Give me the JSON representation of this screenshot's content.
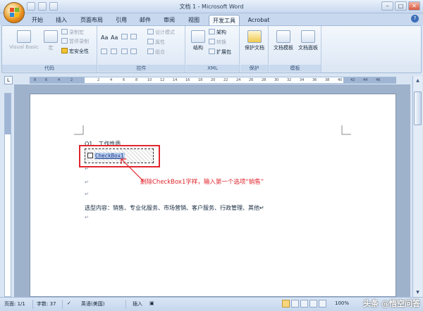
{
  "window": {
    "title": "文档 1 - Microsoft Word",
    "minimize": "–",
    "maximize": "□",
    "close": "✕"
  },
  "tabs": [
    {
      "label": "开始"
    },
    {
      "label": "插入"
    },
    {
      "label": "页面布局"
    },
    {
      "label": "引用"
    },
    {
      "label": "邮件"
    },
    {
      "label": "审阅"
    },
    {
      "label": "视图"
    },
    {
      "label": "开发工具"
    },
    {
      "label": "Acrobat"
    }
  ],
  "help": "?",
  "ribbon": {
    "code": {
      "label": "代码",
      "visual_basic": "Visual Basic",
      "macro": "宏",
      "record_macro": "录制宏",
      "pause_recording": "暂停录制",
      "macro_security": "宏安全性"
    },
    "controls": {
      "label": "控件",
      "design_mode": "设计模式",
      "properties": "属性",
      "group": "组合"
    },
    "xml": {
      "label": "XML",
      "structure": "结构",
      "schema": "架构",
      "transform": "转换",
      "expansion_packs": "扩展包"
    },
    "protect": {
      "label": "保护",
      "protect_document": "保护文档"
    },
    "templates": {
      "label": "模板",
      "document_template": "文档模板",
      "document_panel": "文档面板"
    }
  },
  "ruler": {
    "corner": "L",
    "ticks": [
      "8",
      "6",
      "4",
      "2",
      "2",
      "4",
      "6",
      "8",
      "10",
      "12",
      "14",
      "16",
      "18",
      "20",
      "22",
      "24",
      "26",
      "28",
      "30",
      "32",
      "34",
      "36",
      "38",
      "40",
      "42",
      "44",
      "46"
    ]
  },
  "document": {
    "question": "Q1、工作性质",
    "checkbox_label": "CheckBox1",
    "para_mark": "↵",
    "options_line": "选型内容：销售、专业化服务、市场营销、客户服务、行政管理、其他↵"
  },
  "annotation": {
    "text": "删除CheckBox1字样，输入第一个选项“销售”",
    "color": "#e0262d"
  },
  "status": {
    "page": "页面: 1/1",
    "words": "字数: 37",
    "language": "英语(美国)",
    "mode": "插入",
    "zoom": "100%"
  },
  "watermark": "头条 @悟空问答"
}
